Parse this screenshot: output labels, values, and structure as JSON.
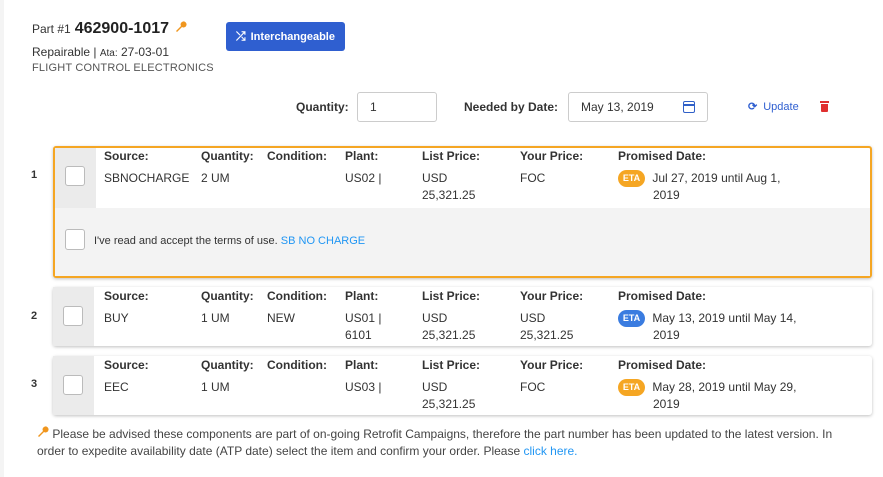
{
  "header": {
    "part_prefix": "Part #1",
    "part_number": "462900-1017",
    "status": "Repairable |",
    "ata_label": "Ata:",
    "ata_value": "27-03-01",
    "category": "FLIGHT CONTROL ELECTRONICS",
    "interchange_label": "Interchangeable"
  },
  "controls": {
    "quantity_label": "Quantity:",
    "quantity_value": "1",
    "date_label": "Needed by Date:",
    "date_value": "May 13, 2019",
    "update_label": "Update"
  },
  "columns": {
    "source": "Source:",
    "quantity": "Quantity:",
    "condition": "Condition:",
    "plant": "Plant:",
    "list_price": "List Price:",
    "your_price": "Your Price:",
    "promised_date": "Promised Date:"
  },
  "rows": [
    {
      "num": "1",
      "source": "SBNOCHARGE",
      "quantity": "2 UM",
      "condition": "",
      "plant_1": "US02 |",
      "plant_2": "",
      "list_price_1": "USD",
      "list_price_2": "25,321.25",
      "your_price_1": "FOC",
      "your_price_2": "",
      "eta": "ETA",
      "eta_color": "#f5a623",
      "promised_1": "Jul 27, 2019 until Aug 1,",
      "promised_2": "2019",
      "terms_text": "I've read and accept the terms of use.",
      "terms_link": "SB NO CHARGE"
    },
    {
      "num": "2",
      "source": "BUY",
      "quantity": "1 UM",
      "condition": "NEW",
      "plant_1": "US01 |",
      "plant_2": "6101",
      "list_price_1": "USD",
      "list_price_2": "25,321.25",
      "your_price_1": "USD",
      "your_price_2": "25,321.25",
      "eta": "ETA",
      "eta_color": "#3a7ce0",
      "promised_1": "May 13, 2019 until May 14,",
      "promised_2": "2019"
    },
    {
      "num": "3",
      "source": "EEC",
      "quantity": "1 UM",
      "condition": "",
      "plant_1": "US03 |",
      "plant_2": "",
      "list_price_1": "USD",
      "list_price_2": "25,321.25",
      "your_price_1": "FOC",
      "your_price_2": "",
      "eta": "ETA",
      "eta_color": "#f5a623",
      "promised_1": "May 28, 2019 until May 29,",
      "promised_2": "2019"
    }
  ],
  "footnote": {
    "text": "Please be advised these components are part of on-going Retrofit Campaigns, therefore the part number has been updated to the latest version. In order to expedite availability date (ATP date) select the item and confirm your order. Please",
    "link": "click here."
  }
}
